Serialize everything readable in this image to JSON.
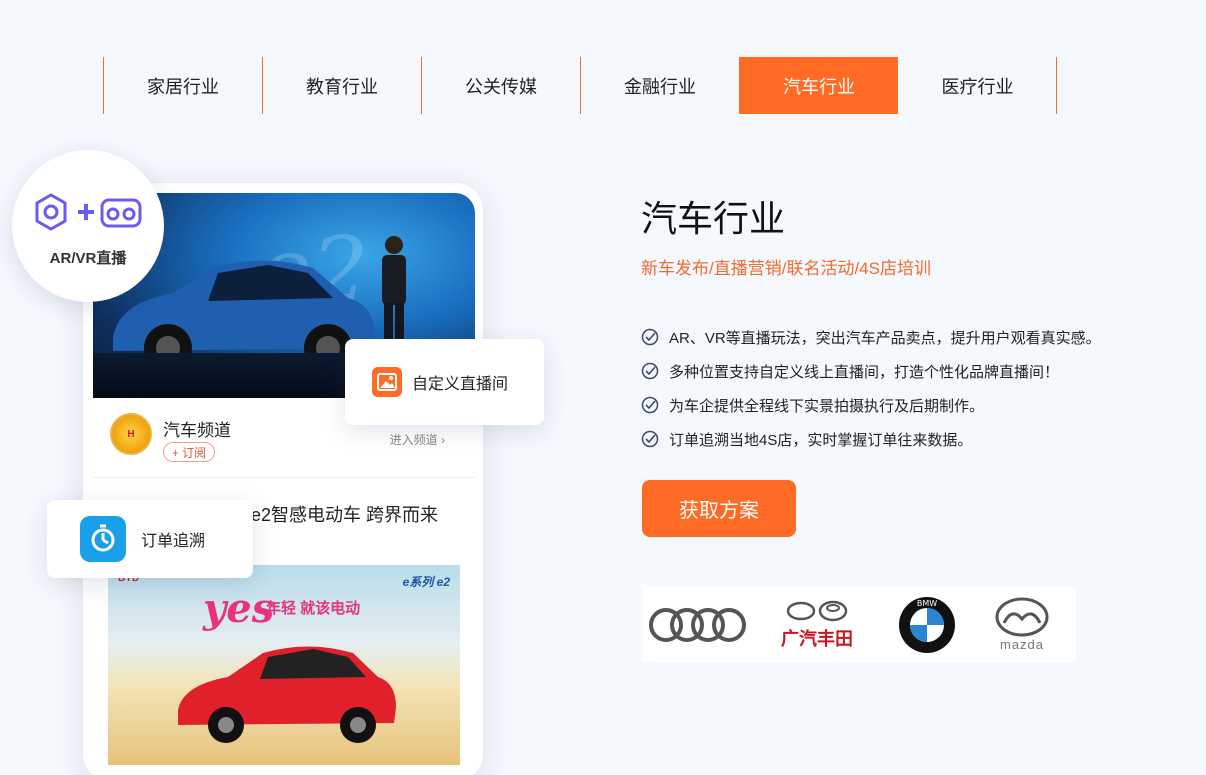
{
  "tabs": [
    {
      "label": "家居行业",
      "active": false
    },
    {
      "label": "教育行业",
      "active": false
    },
    {
      "label": "公关传媒",
      "active": false
    },
    {
      "label": "金融行业",
      "active": false
    },
    {
      "label": "汽车行业",
      "active": true
    },
    {
      "label": "医疗行业",
      "active": false
    }
  ],
  "mockup": {
    "ar_label": "AR/VR直播",
    "custom_room_label": "自定义直播间",
    "order_trace_label": "订单追溯",
    "channel_name": "汽车频道",
    "subscribe_label": "+ 订阅",
    "enter_channel_label": "进入频道",
    "article_title": "e2智感电动车 跨界而来",
    "ad_slogan": "年轻 就该电动",
    "ad_yes": "yes",
    "ad_series": "e系列 e2",
    "ad_badge": "BYD"
  },
  "content": {
    "title": "汽车行业",
    "subtitle": "新车发布/直播营销/联名活动/4S店培训",
    "features": [
      "AR、VR等直播玩法，突出汽车产品卖点，提升用户观看真实感。",
      "多种位置支持自定义线上直播间，打造个性化品牌直播间！",
      "为车企提供全程线下实景拍摄执行及后期制作。",
      "订单追溯当地4S店，实时掌握订单往来数据。"
    ],
    "cta_label": "获取方案"
  },
  "brands": {
    "gac_toyota_text": "广汽丰田",
    "bmw_text": "BMW",
    "mazda_text": "mazda",
    "logos": [
      "audi-logo",
      "gac-toyota-logo",
      "bmw-logo",
      "mazda-logo"
    ]
  },
  "colors": {
    "accent": "#ff6a24",
    "background": "#f5f8fd",
    "check": "#3a4a6b",
    "ar_icon": "#6a5cf0",
    "order_icon": "#1aa0ea"
  }
}
